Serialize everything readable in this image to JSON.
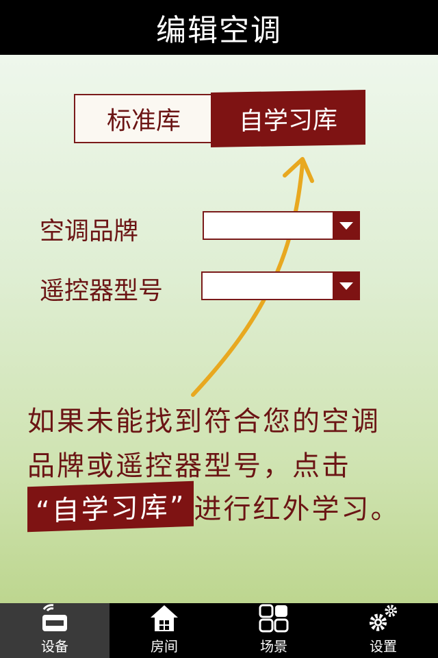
{
  "header": {
    "title": "编辑空调"
  },
  "segmented": {
    "left": "标准库",
    "right": "自学习库",
    "selected": "自学习库"
  },
  "form": {
    "brand_label": "空调品牌",
    "model_label": "遥控器型号",
    "brand_value": "",
    "model_value": ""
  },
  "note": {
    "line1": "如果未能找到符合您的空调",
    "line2": "品牌或遥控器型号，点击",
    "highlight": "“自学习库”",
    "line3_rest": "进行红外学习。"
  },
  "colors": {
    "accent": "#7e1313",
    "arrow": "#e8a820"
  },
  "tabbar": {
    "items": [
      {
        "label": "设备",
        "icon": "device-icon",
        "active": true
      },
      {
        "label": "房间",
        "icon": "house-icon",
        "active": false
      },
      {
        "label": "场景",
        "icon": "grid-icon",
        "active": false
      },
      {
        "label": "设置",
        "icon": "gears-icon",
        "active": false
      }
    ]
  }
}
